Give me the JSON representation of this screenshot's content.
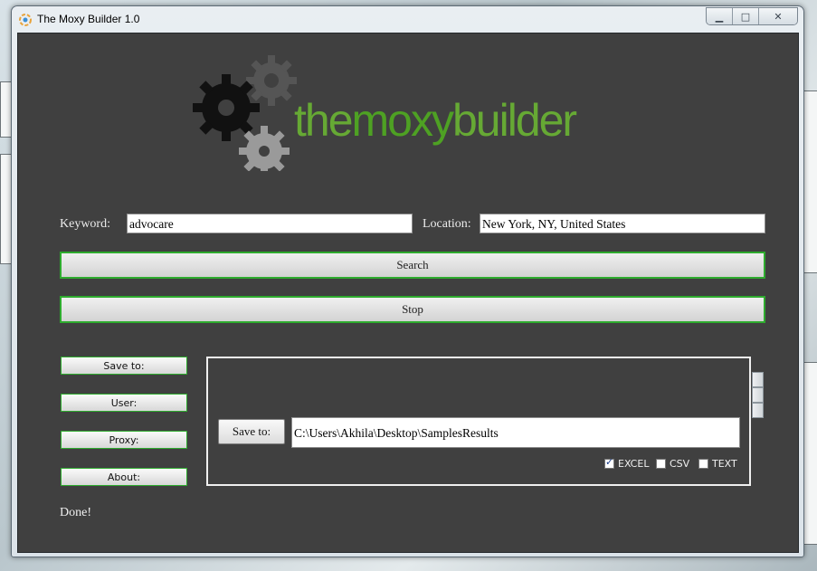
{
  "window": {
    "title": "The Moxy Builder 1.0",
    "controls": {
      "minimize": "▁",
      "maximize": "□",
      "close": "✕"
    }
  },
  "logo": {
    "word1": "the",
    "word2": "moxy",
    "word3": "builder",
    "colors": {
      "green": "#66a934",
      "dark_gear": "#111111",
      "light_gear": "#9a9a9a"
    }
  },
  "search": {
    "keyword_label": "Keyword:",
    "keyword_value": "advocare",
    "location_label": "Location:",
    "location_value": "New York, NY, United States",
    "search_label": "Search",
    "stop_label": "Stop"
  },
  "sidebar": {
    "items": [
      {
        "label": "Save to:"
      },
      {
        "label": "User:"
      },
      {
        "label": "Proxy:"
      },
      {
        "label": "About:"
      }
    ]
  },
  "save_panel": {
    "button_label": "Save to:",
    "path_value": "C:\\Users\\Akhila\\Desktop\\SamplesResults",
    "formats": [
      {
        "label": "EXCEL",
        "checked": true
      },
      {
        "label": "CSV",
        "checked": false
      },
      {
        "label": "TEXT",
        "checked": false
      }
    ]
  },
  "status": {
    "text": "Done!"
  },
  "colors": {
    "accent_border": "#2eab2e",
    "background": "#404040"
  }
}
